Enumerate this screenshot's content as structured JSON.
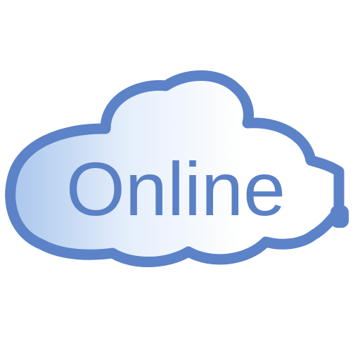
{
  "logo": {
    "word": "Online",
    "colors": {
      "outline": "#5c82c8",
      "text": "#5a80c6",
      "fill_left": "#a9c6ec",
      "fill_mid": "#e4eefb",
      "fill_right": "#ffffff"
    },
    "icon": "cloud-icon"
  }
}
